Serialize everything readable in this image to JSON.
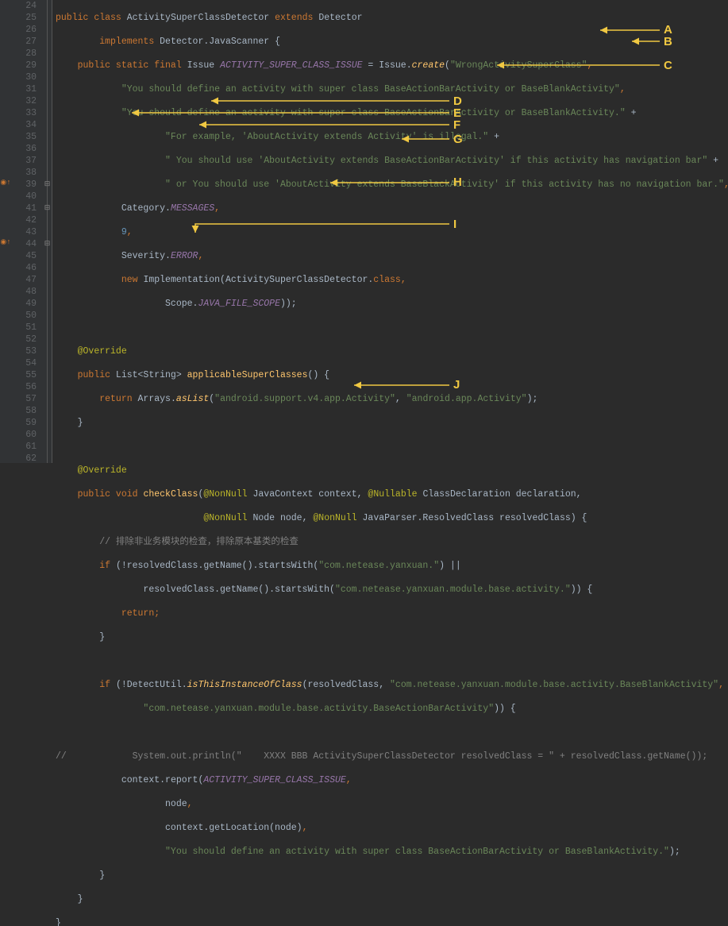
{
  "line_numbers": [
    24,
    25,
    26,
    27,
    28,
    29,
    30,
    31,
    32,
    33,
    34,
    35,
    36,
    37,
    38,
    39,
    40,
    41,
    42,
    43,
    44,
    45,
    46,
    47,
    48,
    49,
    50,
    51,
    52,
    53,
    54,
    55,
    56,
    57,
    58,
    59,
    60,
    61,
    62
  ],
  "annotations": {
    "A": "A",
    "B": "B",
    "C": "C",
    "D": "D",
    "E": "E",
    "F": "F",
    "G": "G",
    "H": "H",
    "I": "I",
    "J": "J"
  },
  "override_marks": [
    39,
    44
  ],
  "code": {
    "l24_kw_public": "public",
    "l24_kw_class": "class",
    "l24_cls": "ActivitySuperClassDetector",
    "l24_kw_ext": "extends",
    "l24_sup": "Detector",
    "l25_kw_impl": "implements",
    "l25_iface": "Detector.JavaScanner {",
    "l26_kw": "public static final ",
    "l26_type": "Issue ",
    "l26_field": "ACTIVITY_SUPER_CLASS_ISSUE",
    "l26_eq": " = Issue.",
    "l26_create": "create",
    "l26_open": "(",
    "l26_str": "\"WrongActivitySuperClass\"",
    "l26_comma": ",",
    "l27_str": "\"You should define an activity with super class BaseActionBarActivity or BaseBlankActivity\"",
    "l27_comma": ",",
    "l28_str": "\"You should define an activity with super class BaseActionBarActivity or BaseBlankActivity.\"",
    "l28_plus": " +",
    "l29_str": "\"For example, 'AboutActivity extends Activity' is illegal.\"",
    "l29_plus": " +",
    "l30_str": "\" You should use 'AboutActivity extends BaseActionBarActivity' if this activity has navigation bar\"",
    "l30_plus": " +",
    "l31_str": "\" or You should use 'AboutActivity extends BaseBlackActivity' if this activity has no navigation bar.\"",
    "l31_comma": ",",
    "l32_pre": "Category.",
    "l32_field": "MESSAGES",
    "l32_comma": ",",
    "l33_num": "9",
    "l33_comma": ",",
    "l34_pre": "Severity.",
    "l34_field": "ERROR",
    "l34_comma": ",",
    "l35_kw_new": "new ",
    "l35_cls": "Implementation(ActivitySuperClassDetector.",
    "l35_kw_class": "class",
    "l35_comma": ",",
    "l36_pre": "Scope.",
    "l36_field": "JAVA_FILE_SCOPE",
    "l36_close": "));",
    "l38_ann": "@Override",
    "l39_kw_public": "public ",
    "l39_ret": "List<String> ",
    "l39_meth": "applicableSuperClasses",
    "l39_paren": "() {",
    "l40_kw_return": "return ",
    "l40_call": "Arrays.",
    "l40_meth": "asList",
    "l40_open": "(",
    "l40_s1": "\"android.support.v4.app.Activity\"",
    "l40_c": ", ",
    "l40_s2": "\"android.app.Activity\"",
    "l40_close": ");",
    "l41_close": "}",
    "l43_ann": "@Override",
    "l44_kw_public": "public void ",
    "l44_meth": "checkClass",
    "l44_open": "(",
    "l44_ann1": "@NonNull ",
    "l44_p1": "JavaContext context, ",
    "l44_ann2": "@Nullable ",
    "l44_p2": "ClassDeclaration declaration,",
    "l45_ann1": "@NonNull ",
    "l45_p1": "Node node, ",
    "l45_ann2": "@NonNull ",
    "l45_p2": "JavaParser.ResolvedClass resolvedClass) {",
    "l46_cmt": "// 排除非业务模块的检查，排除原本基类的检查",
    "l47_kw_if": "if ",
    "l47_cond1": "(!resolvedClass.getName().startsWith(",
    "l47_s1": "\"com.netease.yanxuan.\"",
    "l47_close1": ") ||",
    "l48_cond": "resolvedClass.getName().startsWith(",
    "l48_s1": "\"com.netease.yanxuan.module.base.activity.\"",
    "l48_close": ")) {",
    "l49_kw_return": "return;",
    "l50_close": "}",
    "l52_kw_if": "if ",
    "l52_open": "(!DetectUtil.",
    "l52_meth": "isThisInstanceOfClass",
    "l52_args_open": "(resolvedClass, ",
    "l52_s1": "\"com.netease.yanxuan.module.base.activity.BaseBlankActivity\"",
    "l52_comma": ",",
    "l53_s1": "\"com.netease.yanxuan.module.base.activity.BaseActionBarActivity\"",
    "l53_close": ")) {",
    "l55_cmt": "//            System.out.println(\"    XXXX BBB ActivitySuperClassDetector resolvedClass = \" + resolvedClass.getName());",
    "l56_call": "context.report(",
    "l56_field": "ACTIVITY_SUPER_CLASS_ISSUE",
    "l56_comma": ",",
    "l57_arg": "node",
    "l57_comma": ",",
    "l58_arg": "context.getLocation(node)",
    "l58_comma": ",",
    "l59_str": "\"You should define an activity with super class BaseActionBarActivity or BaseBlankActivity.\"",
    "l59_close": ");",
    "l60_close": "}",
    "l61_close": "}",
    "l62_close": "}"
  }
}
